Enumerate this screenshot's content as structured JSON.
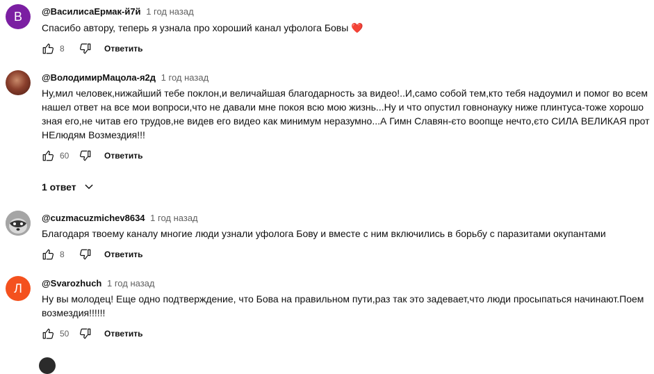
{
  "comments": [
    {
      "author": "@ВасилисаЕрмак-й7й",
      "time": "1 год назад",
      "avatar_letter": "В",
      "avatar_color": "#7b1fa2",
      "text": "Спасибо автору, теперь я узнала про хороший канал уфолога Бовы ❤️",
      "likes": "8",
      "reply_label": "Ответить"
    },
    {
      "author": "@ВолодимирМацола-я2д",
      "time": "1 год назад",
      "avatar_letter": "",
      "avatar_color": "#7a3b2a",
      "text": "Ну,мил человек,нижайший тебе поклон,и величайшая благодарность за видео!..И,само собой тем,кто тебя надоумил и помог во всем\nнашел ответ на все мои вопроси,что не давали мне покоя всю мою жизнь...Ну и что опустил говнонауку ниже плинтуса-тоже хорошо\nзная его,не читав его трудов,не видев его видео как минимум неразумно...А Гимн Славян-єто воопще нечто,єто СИЛА ВЕЛИКАЯ прот\nНЕлюдям Возмездия!!!",
      "likes": "60",
      "reply_label": "Ответить",
      "replies_label": "1 ответ"
    },
    {
      "author": "@cuzmacuzmichev8634",
      "time": "1 год назад",
      "avatar_letter": "",
      "avatar_color": "#8a8a8a",
      "text": "Благодаря твоему каналу многие люди узнали уфолога Бову и вместе с ним включились в борьбу с паразитами окупантами",
      "likes": "8",
      "reply_label": "Ответить"
    },
    {
      "author": "@Svarozhuch",
      "time": "1 год назад",
      "avatar_letter": "Л",
      "avatar_color": "#f4511e",
      "text": "Ну вы молодец! Еще одно подтверждение, что Бова на правильном пути,раз так это задевает,что люди просыпаться начинают.Поем\nвозмездия!!!!!!",
      "likes": "50",
      "reply_label": "Ответить"
    }
  ],
  "icons": {
    "like": "thumb-up-icon",
    "dislike": "thumb-down-icon",
    "expand": "chevron-down-icon"
  }
}
